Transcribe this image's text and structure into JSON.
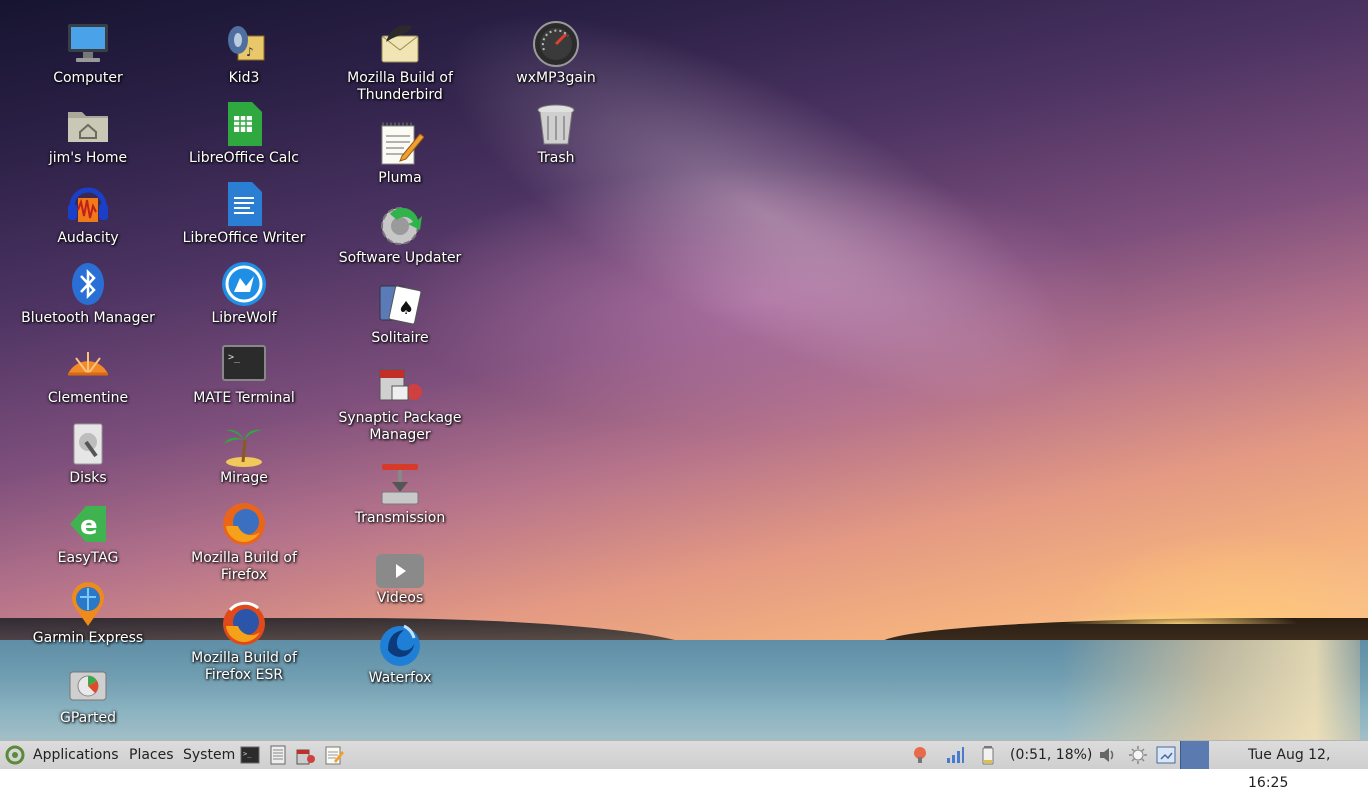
{
  "desktop": {
    "icons": [
      {
        "label": "Computer",
        "icon": "computer-icon"
      },
      {
        "label": "jim's Home",
        "icon": "home-folder-icon"
      },
      {
        "label": "Audacity",
        "icon": "audacity-icon"
      },
      {
        "label": "Bluetooth Manager",
        "icon": "bluetooth-icon"
      },
      {
        "label": "Clementine",
        "icon": "clementine-icon"
      },
      {
        "label": "Disks",
        "icon": "disks-icon"
      },
      {
        "label": "EasyTAG",
        "icon": "easytag-icon"
      },
      {
        "label": "Garmin Express",
        "icon": "garmin-icon"
      },
      {
        "label": "GParted",
        "icon": "gparted-icon"
      },
      {
        "label": "Kid3",
        "icon": "kid3-icon"
      },
      {
        "label": "LibreOffice Calc",
        "icon": "libreoffice-calc-icon"
      },
      {
        "label": "LibreOffice Writer",
        "icon": "libreoffice-writer-icon"
      },
      {
        "label": "LibreWolf",
        "icon": "librewolf-icon"
      },
      {
        "label": "MATE Terminal",
        "icon": "terminal-icon"
      },
      {
        "label": "Mirage",
        "icon": "mirage-icon"
      },
      {
        "label": "Mozilla Build of Firefox",
        "icon": "firefox-icon"
      },
      {
        "label": "Mozilla Build of Firefox ESR",
        "icon": "firefox-esr-icon"
      },
      {
        "label": "Mozilla Build of Thunderbird",
        "icon": "thunderbird-icon"
      },
      {
        "label": "Pluma",
        "icon": "pluma-icon"
      },
      {
        "label": "Software Updater",
        "icon": "software-updater-icon"
      },
      {
        "label": "Solitaire",
        "icon": "solitaire-icon"
      },
      {
        "label": "Synaptic Package Manager",
        "icon": "synaptic-icon"
      },
      {
        "label": "Transmission",
        "icon": "transmission-icon"
      },
      {
        "label": "Videos",
        "icon": "videos-icon"
      },
      {
        "label": "Waterfox",
        "icon": "waterfox-icon"
      },
      {
        "label": "wxMP3gain",
        "icon": "wxmp3gain-icon"
      },
      {
        "label": "Trash",
        "icon": "trash-icon"
      }
    ]
  },
  "taskbar": {
    "menus": [
      "Applications",
      "Places",
      "System"
    ],
    "launchers": [
      "terminal-icon",
      "file-manager-icon",
      "synaptic-icon",
      "text-editor-icon"
    ],
    "battery_status": "(0:51, 18%)",
    "clock": "Tue Aug 12, 16:25"
  }
}
